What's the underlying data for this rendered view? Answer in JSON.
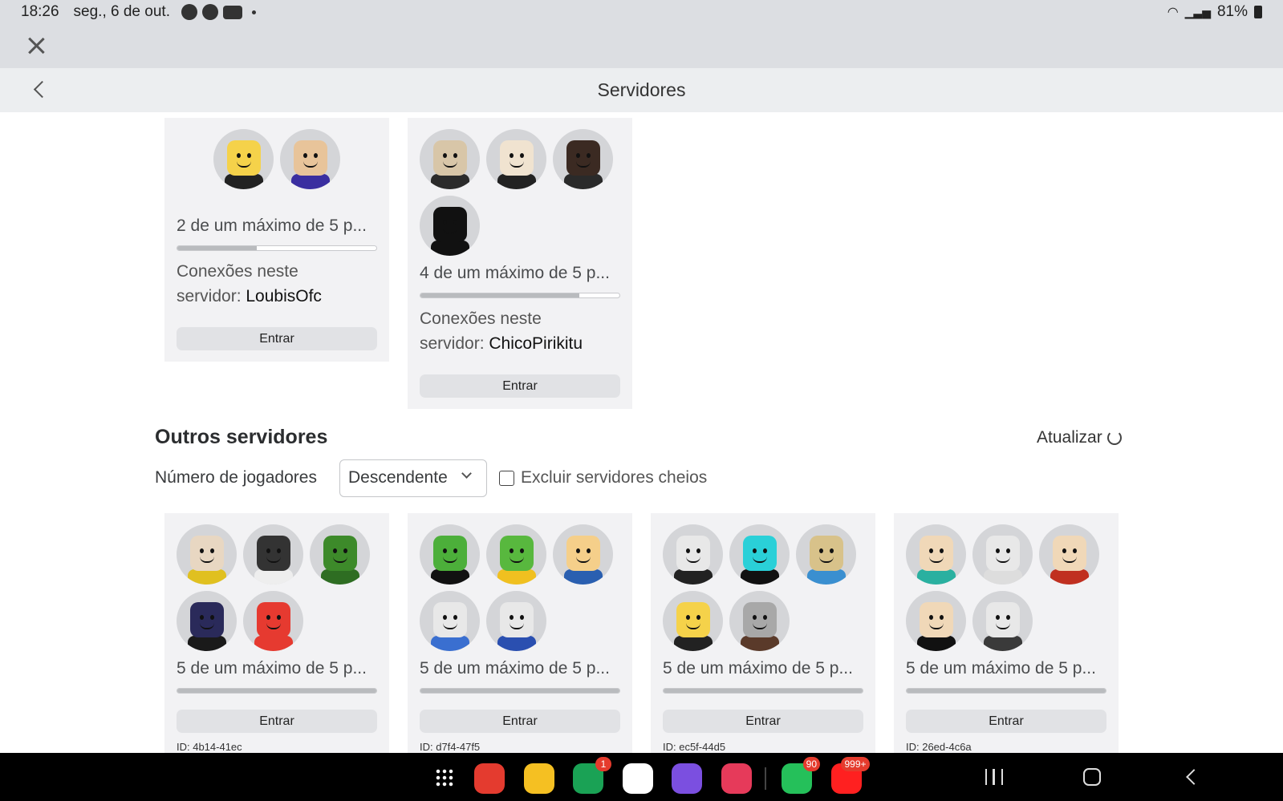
{
  "status_bar": {
    "time": "18:26",
    "date": "seg., 6 de out.",
    "battery": "81%"
  },
  "header": {
    "title": "Servidores"
  },
  "friend_servers": [
    {
      "players_text": "2 de um máximo de 5 p...",
      "fill": 0.4,
      "connections_label": "Conexões neste",
      "connections_prefix": "servidor: ",
      "connection_name": "LoubisOfc",
      "enter_label": "Entrar",
      "avatars": [
        {
          "skin": "#f5d24a",
          "shirt": "#222"
        },
        {
          "skin": "#e8c49a",
          "shirt": "#3a2ea0"
        }
      ]
    },
    {
      "players_text": "4 de um máximo de 5 p...",
      "fill": 0.8,
      "connections_label": "Conexões neste",
      "connections_prefix": "servidor: ",
      "connection_name": "ChicoPirikitu",
      "enter_label": "Entrar",
      "avatars": [
        {
          "skin": "#d8c6a8",
          "shirt": "#2b2b2b"
        },
        {
          "skin": "#f0e3d0",
          "shirt": "#222"
        },
        {
          "skin": "#3b2a22",
          "shirt": "#2a2a2a"
        },
        {
          "skin": "#111",
          "shirt": "#111"
        }
      ]
    }
  ],
  "other_servers": {
    "title": "Outros servidores",
    "refresh_label": "Atualizar",
    "sort_label": "Número de jogadores",
    "sort_value": "Descendente",
    "exclude_full_label": "Excluir servidores cheios",
    "servers": [
      {
        "players_text": "5 de um máximo de 5 p...",
        "fill": 1.0,
        "enter_label": "Entrar",
        "id": "ID: 4b14-41ec",
        "avatars": [
          {
            "skin": "#e8d7c2",
            "shirt": "#e0c020"
          },
          {
            "skin": "#333",
            "shirt": "#eee"
          },
          {
            "skin": "#3d8a2a",
            "shirt": "#2e6d22"
          },
          {
            "skin": "#2a2a5a",
            "shirt": "#1a1a1a"
          },
          {
            "skin": "#e63a30",
            "shirt": "#e63a30"
          }
        ]
      },
      {
        "players_text": "5 de um máximo de 5 p...",
        "fill": 1.0,
        "enter_label": "Entrar",
        "id": "ID: d7f4-47f5",
        "avatars": [
          {
            "skin": "#4caf3a",
            "shirt": "#111"
          },
          {
            "skin": "#58b83e",
            "shirt": "#f0c020"
          },
          {
            "skin": "#f5cf8a",
            "shirt": "#2a5fb0"
          },
          {
            "skin": "#e8e8e8",
            "shirt": "#3a6fd0"
          },
          {
            "skin": "#e8e8e8",
            "shirt": "#2a4fb0"
          }
        ]
      },
      {
        "players_text": "5 de um máximo de 5 p...",
        "fill": 1.0,
        "enter_label": "Entrar",
        "id": "ID: ec5f-44d5",
        "avatars": [
          {
            "skin": "#e8e8e8",
            "shirt": "#222"
          },
          {
            "skin": "#2ad0d8",
            "shirt": "#111"
          },
          {
            "skin": "#d8c28a",
            "shirt": "#3a8fd0"
          },
          {
            "skin": "#f5d24a",
            "shirt": "#222"
          },
          {
            "skin": "#a8a8a8",
            "shirt": "#5a3a2a"
          }
        ]
      },
      {
        "players_text": "5 de um máximo de 5 p...",
        "fill": 1.0,
        "enter_label": "Entrar",
        "id": "ID: 26ed-4c6a",
        "avatars": [
          {
            "skin": "#f0d8b8",
            "shirt": "#2ab0a0"
          },
          {
            "skin": "#e8e8e8",
            "shirt": "#ddd"
          },
          {
            "skin": "#f0d8b8",
            "shirt": "#c03020"
          },
          {
            "skin": "#f0d8b8",
            "shirt": "#111"
          },
          {
            "skin": "#e8e8e8",
            "shirt": "#3a3a3a"
          }
        ]
      }
    ]
  },
  "nav": {
    "apps": [
      {
        "name": "flipboard-app-icon",
        "color": "#e43b2f",
        "badge": ""
      },
      {
        "name": "my-files-app-icon",
        "color": "#f5c022",
        "badge": ""
      },
      {
        "name": "phone-app-icon",
        "color": "#1aa255",
        "badge": "1"
      },
      {
        "name": "messages-app-icon",
        "color": "#ffffff",
        "badge": ""
      },
      {
        "name": "internet-app-icon",
        "color": "#7b4fe0",
        "badge": ""
      },
      {
        "name": "camera-app-icon",
        "color": "#e63a5a",
        "badge": ""
      },
      {
        "name": "whatsapp-app-icon",
        "color": "#25c05a",
        "badge": "90"
      },
      {
        "name": "youtube-app-icon",
        "color": "#ff2020",
        "badge": "999+"
      }
    ]
  }
}
